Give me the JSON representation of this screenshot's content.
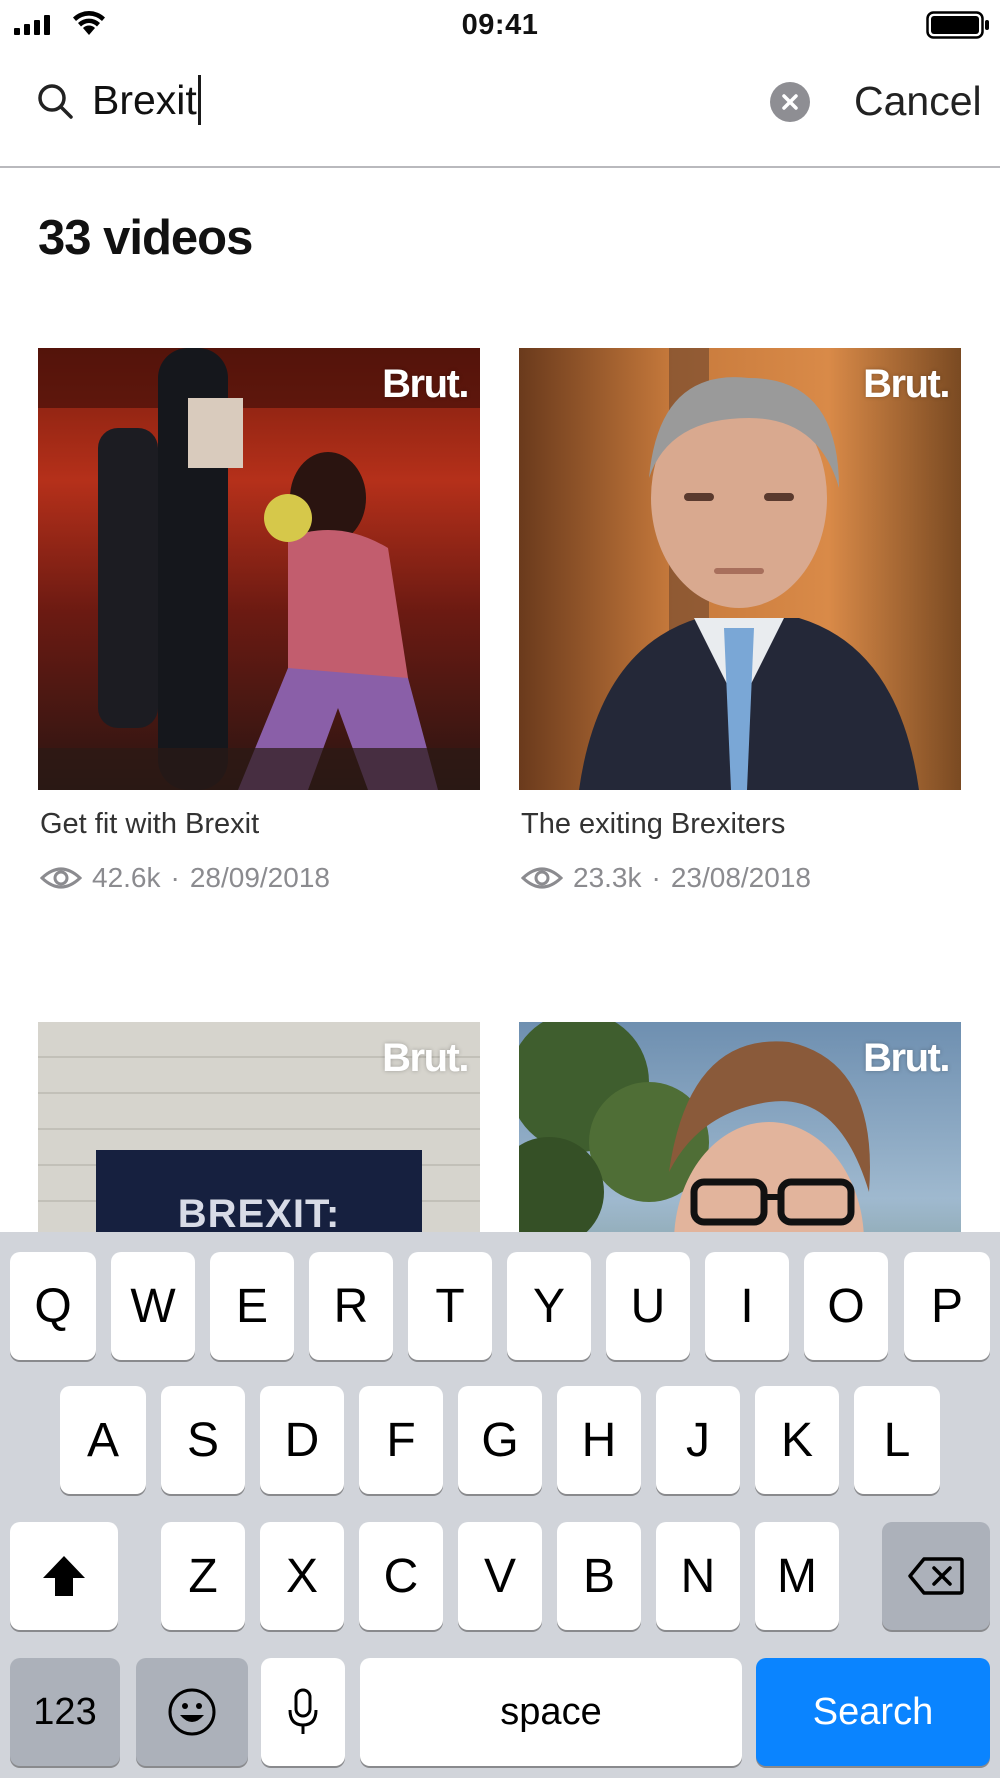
{
  "status_bar": {
    "time": "09:41"
  },
  "search": {
    "query": "Brexit",
    "cancel_label": "Cancel"
  },
  "results": {
    "count_label": "33 videos",
    "videos": [
      {
        "title": "Get fit with Brexit",
        "views": "42.6k",
        "date": "28/09/2018",
        "brand": "Brut."
      },
      {
        "title": "The exiting Brexiters",
        "views": "23.3k",
        "date": "23/08/2018",
        "brand": "Brut."
      },
      {
        "title": "",
        "views": "",
        "date": "",
        "brand": "Brut.",
        "thumb_text": "BREXIT:"
      },
      {
        "title": "",
        "views": "",
        "date": "",
        "brand": "Brut."
      }
    ]
  },
  "keyboard": {
    "row1": [
      "Q",
      "W",
      "E",
      "R",
      "T",
      "Y",
      "U",
      "I",
      "O",
      "P"
    ],
    "row2": [
      "A",
      "S",
      "D",
      "F",
      "G",
      "H",
      "J",
      "K",
      "L"
    ],
    "row3": [
      "Z",
      "X",
      "C",
      "V",
      "B",
      "N",
      "M"
    ],
    "numbers_label": "123",
    "space_label": "space",
    "search_label": "Search",
    "accent_color": "#0a84ff"
  },
  "icons": [
    "signal-icon",
    "wifi-icon",
    "battery-icon",
    "search-icon",
    "clear-icon",
    "eye-icon",
    "shift-icon",
    "backspace-icon",
    "emoji-icon",
    "microphone-icon"
  ]
}
